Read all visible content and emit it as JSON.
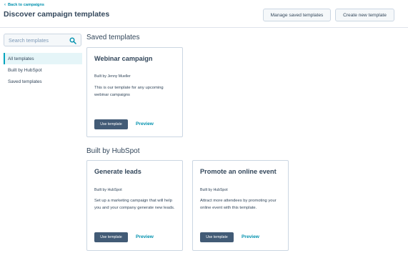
{
  "header": {
    "back_link": "Back to campaigns",
    "title": "Discover campaign templates",
    "manage_button": "Manage saved templates",
    "create_button": "Create new template"
  },
  "sidebar": {
    "search_placeholder": "Search templates",
    "items": [
      {
        "label": "All templates",
        "active": true
      },
      {
        "label": "Built by HubSpot",
        "active": false
      },
      {
        "label": "Saved templates",
        "active": false
      }
    ]
  },
  "sections": {
    "saved": {
      "title": "Saved templates",
      "cards": [
        {
          "title": "Webinar campaign",
          "author": "Built by Jenny Mueller",
          "description": "This is our template for any upcoming webinar campaigns",
          "use_label": "Use template",
          "preview_label": "Preview"
        }
      ]
    },
    "hubspot": {
      "title": "Built by HubSpot",
      "cards": [
        {
          "title": "Generate leads",
          "author": "Built by HubSpot",
          "description": "Set up a marketing campaign that will help you and your company generate new leads.",
          "use_label": "Use template",
          "preview_label": "Preview"
        },
        {
          "title": "Promote an online event",
          "author": "Built by HubSpot",
          "description": "Attract more attendees by promoting your online event with this template.",
          "use_label": "Use template",
          "preview_label": "Preview"
        }
      ]
    }
  },
  "colors": {
    "accent": "#0091ae",
    "primary_button": "#425b76",
    "text": "#33475b",
    "active_nav_bg": "#e5f5f8"
  },
  "icons": {
    "back": "chevron-left-icon",
    "search": "search-icon"
  }
}
